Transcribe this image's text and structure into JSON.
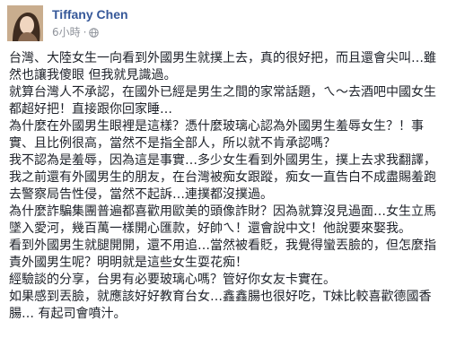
{
  "post": {
    "author": "Tiffany Chen",
    "time": "6小時",
    "privacy_icon": "globe-icon",
    "paragraphs": [
      "台灣、大陸女生一向看到外國男生就撲上去，真的很好把，而且還會尖叫…雖然也讓我傻眼 但我就見識過。",
      "就算台灣人不承認，在國外已經是男生之間的家常話題，ㄟ～去酒吧中國女生都超好把！直接跟你回家睡…",
      "為什麼在外國男生眼裡是這樣？憑什麼玻璃心認為外國男生羞辱女生？！事實、且比例很高，當然不是指全部人，所以就不肯承認嗎？",
      "我不認為是羞辱，因為這是事實…多少女生看到外國男生，撲上去求我翻譯，我之前還有外國男生的朋友，在台灣被痴女跟蹤，痴女一直告白不成盡賜羞跑去警察局告性侵，當然不起訴…連撲都沒撲過。",
      "為什麼詐騙集團普遍都喜歡用歐美的頭像詐財？因為就算沒見過面…女生立馬墜入愛河，幾百萬一樣開心匯款，好帥ㄟ！還會說中文！他說要來娶我。",
      "看到外國男生就腿開開，還不用追…當然被看貶，我覺得蠻丟臉的，但怎麼指責外國男生呢？明明就是這些女生耍花痴！",
      "經驗談的分享，台男有必要玻璃心嗎？管好你女友卡實在。",
      "如果感到丟臉，就應該好好教育台女…鑫鑫腸也很好吃，T妹比較喜歡德國香腸… 有起司會噴汁。"
    ]
  }
}
